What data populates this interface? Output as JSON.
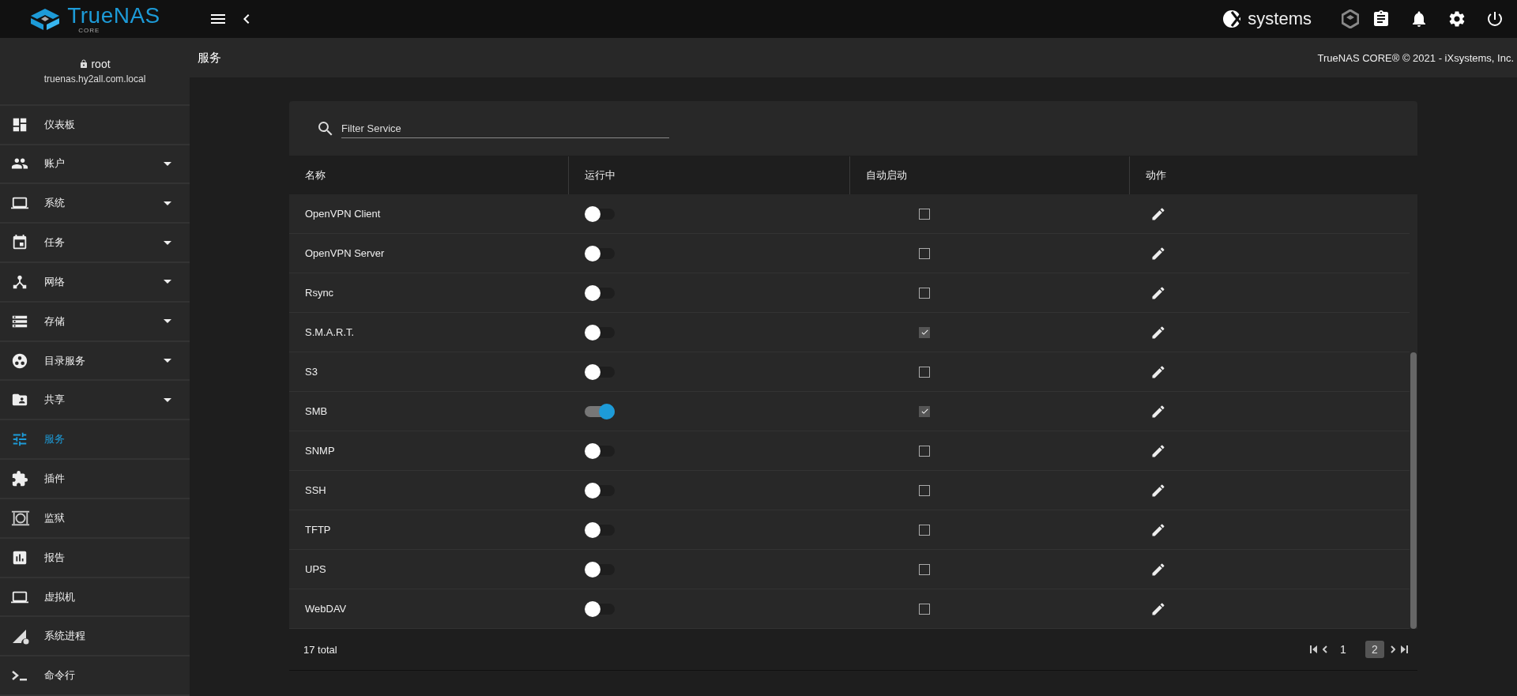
{
  "topbar": {
    "logo_text": "TrueNAS",
    "logo_sub": "CORE",
    "vendor": "systems"
  },
  "user": {
    "name": "root",
    "host": "truenas.hy2all.com.local"
  },
  "sidebar": {
    "items": [
      {
        "label": "仪表板",
        "expandable": false,
        "selected": false
      },
      {
        "label": "账户",
        "expandable": true,
        "selected": false
      },
      {
        "label": "系统",
        "expandable": true,
        "selected": false
      },
      {
        "label": "任务",
        "expandable": true,
        "selected": false
      },
      {
        "label": "网络",
        "expandable": true,
        "selected": false
      },
      {
        "label": "存储",
        "expandable": true,
        "selected": false
      },
      {
        "label": "目录服务",
        "expandable": true,
        "selected": false
      },
      {
        "label": "共享",
        "expandable": true,
        "selected": false
      },
      {
        "label": "服务",
        "expandable": false,
        "selected": true
      },
      {
        "label": "插件",
        "expandable": false,
        "selected": false
      },
      {
        "label": "监狱",
        "expandable": false,
        "selected": false
      },
      {
        "label": "报告",
        "expandable": false,
        "selected": false
      },
      {
        "label": "虚拟机",
        "expandable": false,
        "selected": false
      },
      {
        "label": "系统进程",
        "expandable": false,
        "selected": false
      },
      {
        "label": "命令行",
        "expandable": false,
        "selected": false
      }
    ]
  },
  "page": {
    "title": "服务",
    "copyright": "TrueNAS CORE® © 2021 - iXsystems, Inc."
  },
  "filter": {
    "placeholder": "Filter Service"
  },
  "table": {
    "columns": [
      "名称",
      "运行中",
      "自动启动",
      "动作"
    ],
    "rows": [
      {
        "name": "OpenVPN Client",
        "running": false,
        "autostart": false
      },
      {
        "name": "OpenVPN Server",
        "running": false,
        "autostart": false
      },
      {
        "name": "Rsync",
        "running": false,
        "autostart": false
      },
      {
        "name": "S.M.A.R.T.",
        "running": false,
        "autostart": true
      },
      {
        "name": "S3",
        "running": false,
        "autostart": false
      },
      {
        "name": "SMB",
        "running": true,
        "autostart": true
      },
      {
        "name": "SNMP",
        "running": false,
        "autostart": false
      },
      {
        "name": "SSH",
        "running": false,
        "autostart": false
      },
      {
        "name": "TFTP",
        "running": false,
        "autostart": false
      },
      {
        "name": "UPS",
        "running": false,
        "autostart": false
      },
      {
        "name": "WebDAV",
        "running": false,
        "autostart": false
      }
    ]
  },
  "footer": {
    "total": "17 total",
    "pages": [
      {
        "label": "1",
        "selected": false
      },
      {
        "label": "2",
        "selected": true
      }
    ]
  }
}
